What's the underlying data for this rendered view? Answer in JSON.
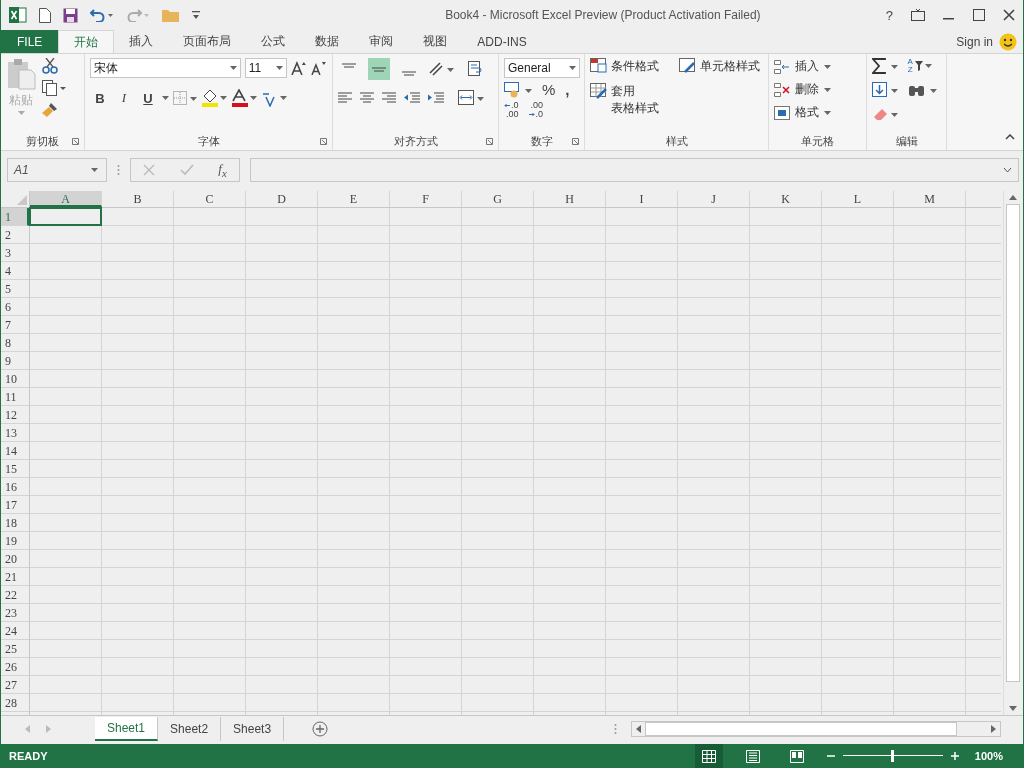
{
  "window": {
    "title": "Book4 - Microsoft Excel Preview (Product Activation Failed)",
    "help": "?"
  },
  "tabs": [
    {
      "label": "FILE",
      "kind": "file",
      "selected": false
    },
    {
      "label": "开始",
      "kind": "tab",
      "selected": true
    },
    {
      "label": "插入",
      "kind": "tab",
      "selected": false
    },
    {
      "label": "页面布局",
      "kind": "tab",
      "selected": false
    },
    {
      "label": "公式",
      "kind": "tab",
      "selected": false
    },
    {
      "label": "数据",
      "kind": "tab",
      "selected": false
    },
    {
      "label": "审阅",
      "kind": "tab",
      "selected": false
    },
    {
      "label": "视图",
      "kind": "tab",
      "selected": false
    },
    {
      "label": "ADD-INS",
      "kind": "tab",
      "selected": false
    }
  ],
  "account": {
    "label": "Sign in"
  },
  "ribbon": {
    "clipboard": {
      "label": "剪切板",
      "paste": "粘贴"
    },
    "font": {
      "label": "字体",
      "font_name": "宋体",
      "font_size": "11",
      "bold": "B",
      "italic": "I",
      "underline": "U"
    },
    "alignment": {
      "label": "对齐方式",
      "vertical": [
        {
          "kind": "top",
          "selected": false
        },
        {
          "kind": "middle",
          "selected": true
        },
        {
          "kind": "bottom",
          "selected": false
        }
      ]
    },
    "number": {
      "label": "数字",
      "format": "General",
      "percent": "%",
      "comma": ",",
      "increase_decimal": {
        "top": ".0",
        "bottom": ".00"
      },
      "decrease_decimal": {
        "top": ".00",
        "bottom": ".0"
      }
    },
    "styles": {
      "label": "样式",
      "conditional": "条件格式",
      "cell_styles": "单元格样式",
      "table_line1": "套用",
      "table_line2": "表格样式"
    },
    "cells": {
      "label": "单元格",
      "items": [
        {
          "kind": "insert",
          "label": "插入"
        },
        {
          "kind": "delete",
          "label": "删除"
        },
        {
          "kind": "format",
          "label": "格式"
        }
      ]
    },
    "editing": {
      "label": "编辑",
      "sort": {
        "top": "A",
        "bottom": "Z"
      }
    }
  },
  "formula_bar": {
    "name_box": "A1",
    "fx": "f$_{x}$"
  },
  "grid": {
    "columns": [
      {
        "label": "A",
        "selected": true
      },
      {
        "label": "B",
        "selected": false
      },
      {
        "label": "C",
        "selected": false
      },
      {
        "label": "D",
        "selected": false
      },
      {
        "label": "E",
        "selected": false
      },
      {
        "label": "F",
        "selected": false
      },
      {
        "label": "G",
        "selected": false
      },
      {
        "label": "H",
        "selected": false
      },
      {
        "label": "I",
        "selected": false
      },
      {
        "label": "J",
        "selected": false
      },
      {
        "label": "K",
        "selected": false
      },
      {
        "label": "L",
        "selected": false
      },
      {
        "label": "M",
        "selected": false
      }
    ],
    "rows": [
      {
        "label": "1",
        "selected": true
      },
      {
        "label": "2",
        "selected": false
      },
      {
        "label": "3",
        "selected": false
      },
      {
        "label": "4",
        "selected": false
      },
      {
        "label": "5",
        "selected": false
      },
      {
        "label": "6",
        "selected": false
      },
      {
        "label": "7",
        "selected": false
      },
      {
        "label": "8",
        "selected": false
      },
      {
        "label": "9",
        "selected": false
      },
      {
        "label": "10",
        "selected": false
      },
      {
        "label": "11",
        "selected": false
      },
      {
        "label": "12",
        "selected": false
      },
      {
        "label": "13",
        "selected": false
      },
      {
        "label": "14",
        "selected": false
      },
      {
        "label": "15",
        "selected": false
      },
      {
        "label": "16",
        "selected": false
      },
      {
        "label": "17",
        "selected": false
      },
      {
        "label": "18",
        "selected": false
      },
      {
        "label": "19",
        "selected": false
      },
      {
        "label": "20",
        "selected": false
      },
      {
        "label": "21",
        "selected": false
      },
      {
        "label": "22",
        "selected": false
      },
      {
        "label": "23",
        "selected": false
      },
      {
        "label": "24",
        "selected": false
      },
      {
        "label": "25",
        "selected": false
      },
      {
        "label": "26",
        "selected": false
      },
      {
        "label": "27",
        "selected": false
      },
      {
        "label": "28",
        "selected": false
      }
    ]
  },
  "sheets": [
    {
      "label": "Sheet1",
      "selected": true
    },
    {
      "label": "Sheet2",
      "selected": false
    },
    {
      "label": "Sheet3",
      "selected": false
    }
  ],
  "status_bar": {
    "status": "READY",
    "zoom": "100%",
    "zoom_slider": {
      "level": 0.5
    },
    "views": [
      {
        "kind": "normal",
        "selected": true
      },
      {
        "kind": "page_layout",
        "selected": false
      },
      {
        "kind": "page_break",
        "selected": false
      }
    ]
  }
}
